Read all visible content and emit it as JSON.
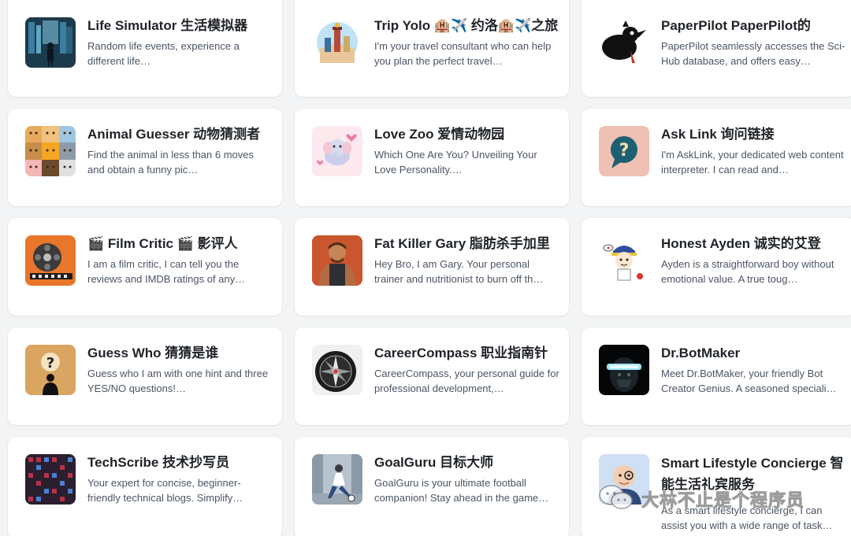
{
  "cards": [
    {
      "title": "Life Simulator 生活模拟器",
      "description": "Random life events, experience a different life…",
      "icon": "man-in-data-room-thumbnail"
    },
    {
      "title": "Trip Yolo 🏨✈️ 约洛🏨✈️之旅",
      "description": "I'm your travel consultant who can help you plan the perfect travel…",
      "icon": "travel-globe-thumbnail"
    },
    {
      "title": "PaperPilot PaperPilot的",
      "description": "PaperPilot seamlessly accesses the Sci-Hub database, and offers easy…",
      "icon": "black-bird-thumbnail"
    },
    {
      "title": "Animal Guesser 动物猜测者",
      "description": "Find the animal in less than 6 moves and obtain a funny pic…",
      "icon": "animal-faces-grid-thumbnail"
    },
    {
      "title": "Love Zoo 爱情动物园",
      "description": "Which One Are You? Unveiling Your Love Personality.…",
      "icon": "pink-elephant-thumbnail"
    },
    {
      "title": "Ask Link 询问链接",
      "description": "I'm AskLink, your dedicated web content interpreter. I can read and…",
      "icon": "question-bubble-thumbnail"
    },
    {
      "title": "🎬 Film Critic 🎬 影评人",
      "description": "I am a film critic, I can tell you the reviews and IMDB ratings of any…",
      "icon": "film-reel-thumbnail"
    },
    {
      "title": "Fat Killer Gary 脂肪杀手加里",
      "description": "Hey Bro, I am Gary. Your personal trainer and nutritionist to burn off th…",
      "icon": "muscle-trainer-thumbnail"
    },
    {
      "title": "Honest Ayden 诚实的艾登",
      "description": "Ayden is a straightforward boy without emotional value. A true toug…",
      "icon": "cartoon-boy-thumbnail"
    },
    {
      "title": "Guess Who 猜猜是谁",
      "description": "Guess who I am with one hint and three YES/NO questions!…",
      "icon": "silhouette-question-thumbnail"
    },
    {
      "title": "CareerCompass 职业指南针",
      "description": "CareerCompass, your personal guide for professional development,…",
      "icon": "compass-thumbnail"
    },
    {
      "title": "Dr.BotMaker",
      "description": "Meet Dr.BotMaker, your friendly Bot Creator Genius. A seasoned speciali…",
      "icon": "robot-visor-thumbnail"
    },
    {
      "title": "TechScribe 技术抄写员",
      "description": "Your expert for concise, beginner-friendly technical blogs. Simplify…",
      "icon": "circuit-board-thumbnail"
    },
    {
      "title": "GoalGuru 目标大师",
      "description": "GoalGuru is your ultimate football companion! Stay ahead in the game…",
      "icon": "football-player-thumbnail"
    },
    {
      "title": "Smart Lifestyle Concierge 智能生活礼宾服务",
      "description": "As a smart lifestyle concierge, I can assist you with a wide range of task…",
      "icon": "old-man-monocle-thumbnail"
    }
  ],
  "watermark": {
    "text": "大林不止是个程序员",
    "icon": "wechat-icon"
  },
  "colors": {
    "background": "#f3f4f6",
    "card": "#ffffff",
    "title": "#1f2328",
    "description": "#4b5563"
  }
}
